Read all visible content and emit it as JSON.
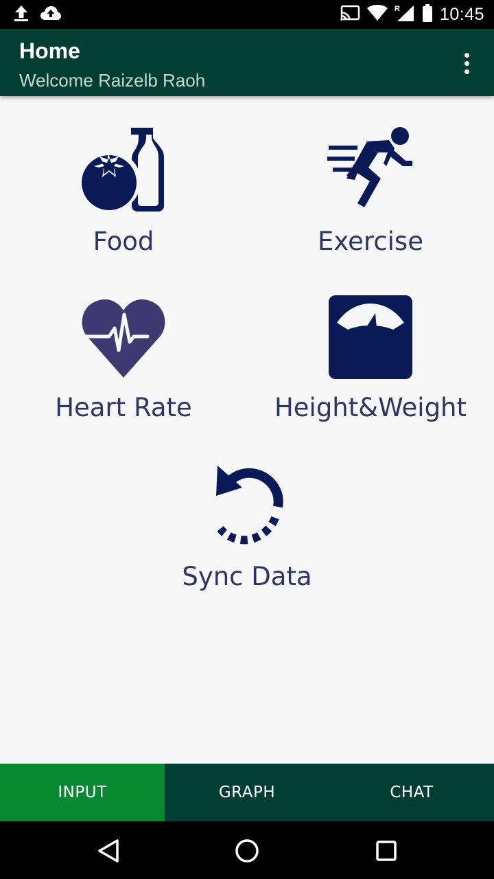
{
  "status_bar": {
    "time": "10:45",
    "icons": [
      "upload-icon",
      "cloud-upload-icon",
      "cast-icon",
      "wifi-icon",
      "signal-roaming-icon",
      "battery-icon"
    ]
  },
  "app_bar": {
    "title": "Home",
    "subtitle": "Welcome Raizelb Raoh",
    "menu_icon": "more-vert-icon"
  },
  "tiles": [
    {
      "label": "Food",
      "icon": "food-icon"
    },
    {
      "label": "Exercise",
      "icon": "exercise-icon"
    },
    {
      "label": "Heart Rate",
      "icon": "heart-rate-icon"
    },
    {
      "label": "Height&Weight",
      "icon": "scale-icon"
    },
    {
      "label": "Sync Data",
      "icon": "sync-icon"
    }
  ],
  "tabs": [
    {
      "label": "INPUT",
      "active": true
    },
    {
      "label": "GRAPH",
      "active": false
    },
    {
      "label": "CHAT",
      "active": false
    }
  ],
  "nav_bar": {
    "buttons": [
      "back-icon",
      "home-icon",
      "recents-icon"
    ]
  },
  "colors": {
    "app_bar": "#003d32",
    "active_tab": "#058a32",
    "icon_navy": "#0a1a57",
    "heart_purple": "#3d3a72",
    "label_text": "#2f3561",
    "background": "#f7f7f8"
  }
}
